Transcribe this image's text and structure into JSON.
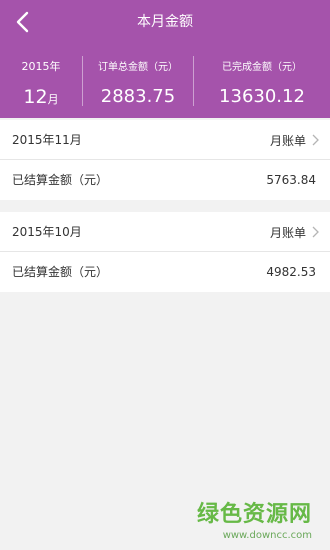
{
  "header": {
    "title": "本月金额",
    "back_icon": "chevron-left-icon",
    "background": "#a553ab"
  },
  "summary": {
    "year": "2015年",
    "month_number": "12",
    "month_unit": "月",
    "order_total_label": "订单总金额（元）",
    "order_total_value": "2883.75",
    "completed_label": "已完成金额（元）",
    "completed_value": "13630.12"
  },
  "months": [
    {
      "period": "2015年11月",
      "bill_link": "月账单",
      "settled_label": "已结算金额（元）",
      "settled_value": "5763.84"
    },
    {
      "period": "2015年10月",
      "bill_link": "月账单",
      "settled_label": "已结算金额（元）",
      "settled_value": "4982.53"
    }
  ],
  "watermark": {
    "main": "绿色资源网",
    "sub": "www.downcc.com"
  }
}
